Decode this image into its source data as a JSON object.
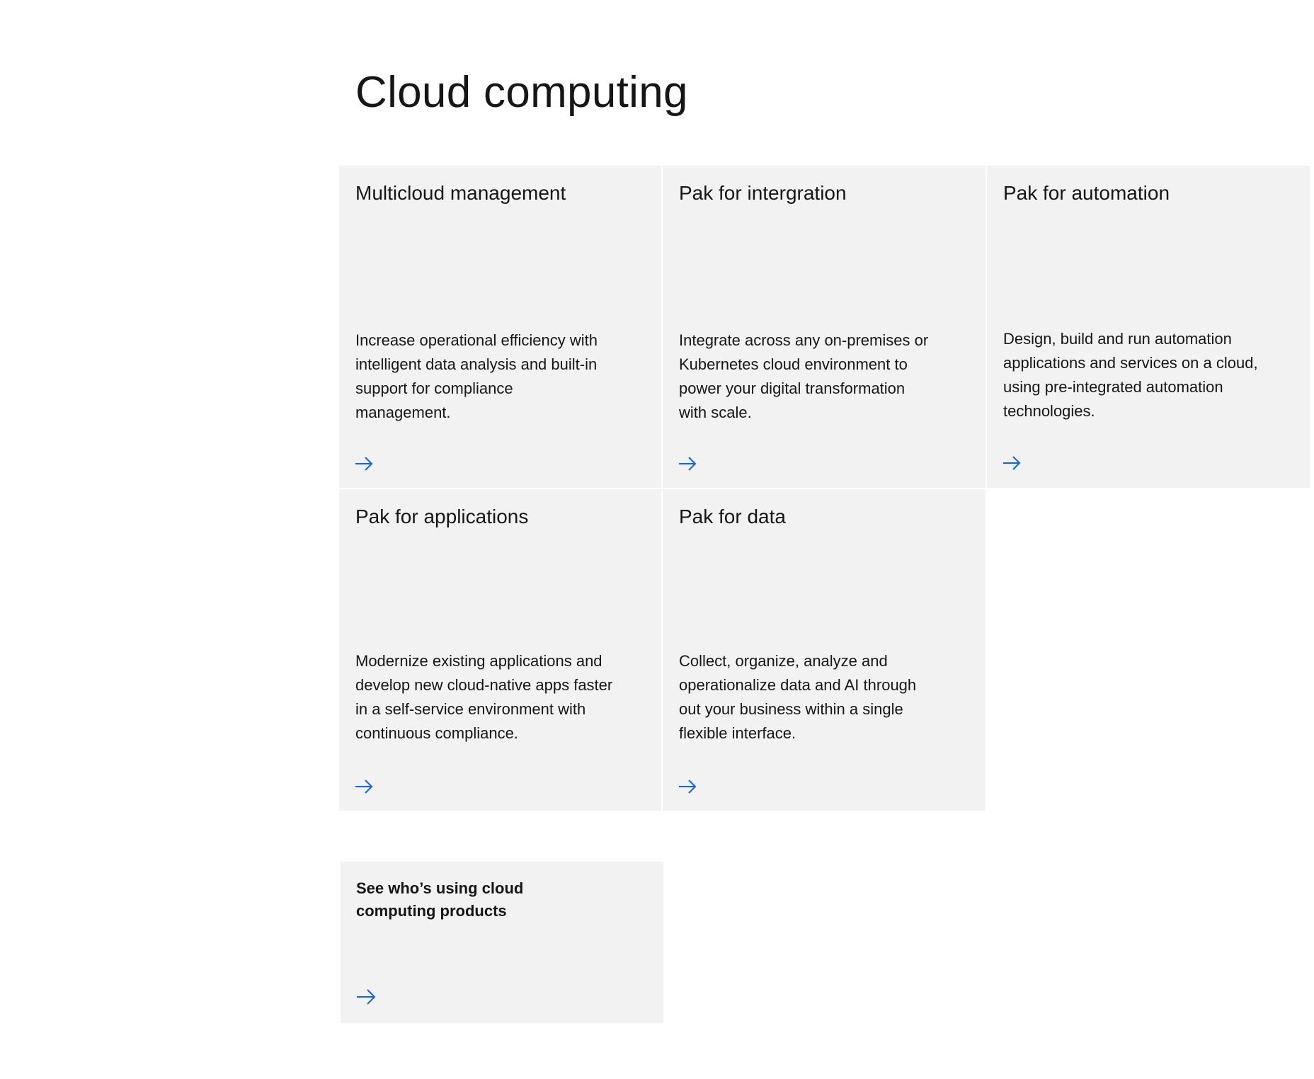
{
  "page": {
    "title": "Cloud computing"
  },
  "accent_color": "#0f62fe",
  "card_background": "#f2f2f2",
  "cards": [
    {
      "title": "Multicloud management",
      "description": "Increase operational efficiency with intelligent data analysis and built-in support for compliance management.",
      "link_icon": "arrow-right-icon"
    },
    {
      "title": "Pak for intergration",
      "description": "Integrate across any on-premises or Kubernetes cloud environment to power your digital transformation with scale.",
      "link_icon": "arrow-right-icon"
    },
    {
      "title": "Pak for automation",
      "description": "Design, build and run automation applications and services on a cloud, using pre-integrated automation technologies.",
      "link_icon": "arrow-right-icon"
    },
    {
      "title": "Pak for applications",
      "description": "Modernize existing applications and develop new cloud-native apps faster in a self-service environment with continuous compliance.",
      "link_icon": "arrow-right-icon"
    },
    {
      "title": "Pak for data",
      "description": "Collect, organize, analyze and operationalize data and AI through out your business within a single flexible interface.",
      "link_icon": "arrow-right-icon"
    }
  ],
  "cta": {
    "title": "See who’s using cloud computing products",
    "link_icon": "arrow-right-icon"
  }
}
